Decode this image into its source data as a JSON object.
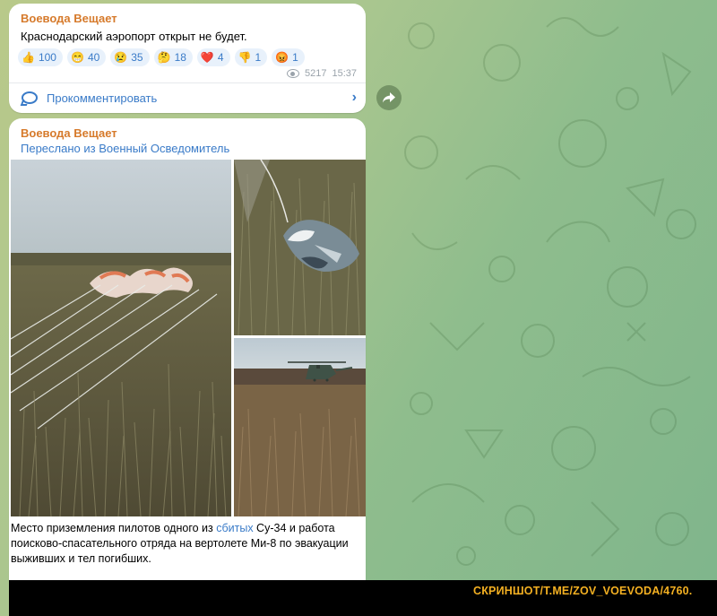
{
  "message1": {
    "author": "Воевода Вещает",
    "text": "Краснодарский аэропорт открыт не будет.",
    "reactions": [
      {
        "emoji": "👍",
        "count": "100"
      },
      {
        "emoji": "😁",
        "count": "40"
      },
      {
        "emoji": "😢",
        "count": "35"
      },
      {
        "emoji": "🤔",
        "count": "18"
      },
      {
        "emoji": "❤️",
        "count": "4"
      },
      {
        "emoji": "👎",
        "count": "1"
      },
      {
        "emoji": "😡",
        "count": "1"
      }
    ],
    "views": "5217",
    "time": "15:37",
    "comment_label": "Прокомментировать"
  },
  "message2": {
    "author": "Воевода Вещает",
    "forwarded_prefix": "Переслано из ",
    "forwarded_from": "Военный Осведомитель",
    "caption_before": "Место приземления пилотов одного из ",
    "caption_link": "сбитых",
    "caption_after": " Су-34 и работа поисково-спасательного отряда на вертолете Ми-8 по эвакуации выживших и тел погибших."
  },
  "watermark": "СКРИНШОТ/T.ME/ZOV_VOEVODA/4760.",
  "colors": {
    "author": "#d67a2b",
    "link": "#3a7bc8",
    "watermark": "#f3b022"
  }
}
